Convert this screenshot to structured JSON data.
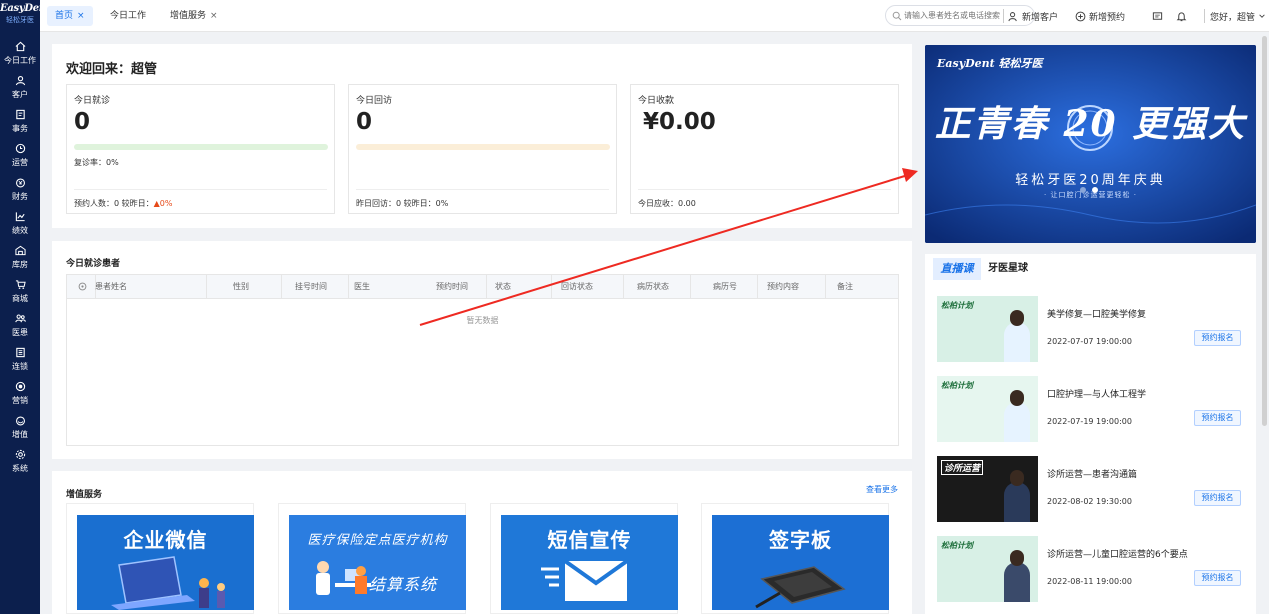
{
  "app": {
    "logo_text": "EasyDent",
    "logo_sub": "轻松牙医"
  },
  "sidebar": {
    "items": [
      {
        "label": "今日工作",
        "icon": "home-icon"
      },
      {
        "label": "客户",
        "icon": "user-icon"
      },
      {
        "label": "事务",
        "icon": "task-icon"
      },
      {
        "label": "运营",
        "icon": "clock-icon"
      },
      {
        "label": "财务",
        "icon": "wallet-icon"
      },
      {
        "label": "绩效",
        "icon": "chart-icon"
      },
      {
        "label": "库房",
        "icon": "warehouse-icon"
      },
      {
        "label": "商城",
        "icon": "cart-icon"
      },
      {
        "label": "医患",
        "icon": "people-icon"
      },
      {
        "label": "连锁",
        "icon": "building-icon"
      },
      {
        "label": "营销",
        "icon": "megaphone-icon"
      },
      {
        "label": "增值",
        "icon": "gift-icon"
      },
      {
        "label": "系统",
        "icon": "gear-icon"
      }
    ]
  },
  "topbar": {
    "tabs": [
      {
        "label": "首页",
        "closable": true,
        "active": true
      },
      {
        "label": "今日工作",
        "closable": false,
        "active": false
      },
      {
        "label": "增值服务",
        "closable": true,
        "active": false
      }
    ],
    "close_glyph": "×",
    "search_placeholder": "请输入患者姓名或电话搜索",
    "new_customer": "新增客户",
    "new_appointment": "新增预约",
    "greeting": "您好，超管"
  },
  "dashboard": {
    "welcome": "欢迎回来：超管",
    "visits": {
      "title": "今日就诊",
      "value": "0",
      "rate": "复诊率：0%",
      "footer": "预约人数：0   较昨日：",
      "trend": "▲0%"
    },
    "followups": {
      "title": "今日回访",
      "value": "0",
      "footer": "昨日回访：0   较昨日：0%"
    },
    "payments": {
      "title": "今日收款",
      "value": "¥0.00",
      "footer": "今日应收：0.00"
    }
  },
  "patients": {
    "title": "今日就诊患者",
    "columns": [
      "患者姓名",
      "性别",
      "挂号时间",
      "医生",
      "预约时间",
      "状态",
      "回访状态",
      "病历状态",
      "病历号",
      "预约内容",
      "备注"
    ],
    "empty_text": "暂无数据"
  },
  "services": {
    "title": "增值服务",
    "more": "查看更多",
    "cards": [
      {
        "label": "企业微信"
      },
      {
        "label": "医疗保险定点医疗机构",
        "label2": "结算系统"
      },
      {
        "label": "短信宣传"
      },
      {
        "label": "签字板"
      }
    ]
  },
  "banner": {
    "brand": "EasyDent 轻松牙医",
    "headline": "正青春 20 更强大",
    "subtitle": "轻松牙医20周年庆典",
    "tagline": "· 让口腔门诊运营更轻松 ·"
  },
  "live": {
    "tab_active": "直播课",
    "tab_other": "牙医星球",
    "items": [
      {
        "title": "美学修复—口腔美学修复",
        "date": "2022-07-07 19:00:00",
        "button": "预约报名",
        "thumb": "松柏计划"
      },
      {
        "title": "口腔护理—与人体工程学",
        "date": "2022-07-19 19:00:00",
        "button": "预约报名",
        "thumb": "松柏计划"
      },
      {
        "title": "诊所运营—患者沟通篇",
        "date": "2022-08-02 19:30:00",
        "button": "预约报名",
        "thumb": "诊所运营"
      },
      {
        "title": "诊所运营—儿童口腔运营的6个要点",
        "date": "2022-08-11 19:00:00",
        "button": "预约报名",
        "thumb": "松柏计划"
      }
    ]
  },
  "colors": {
    "sidebar_bg": "#0c1f4d",
    "primary": "#1a73e8",
    "visit_bar": "#dff3dc",
    "followup_bar": "#fbeed8",
    "annotation_arrow": "#ee2a22"
  }
}
